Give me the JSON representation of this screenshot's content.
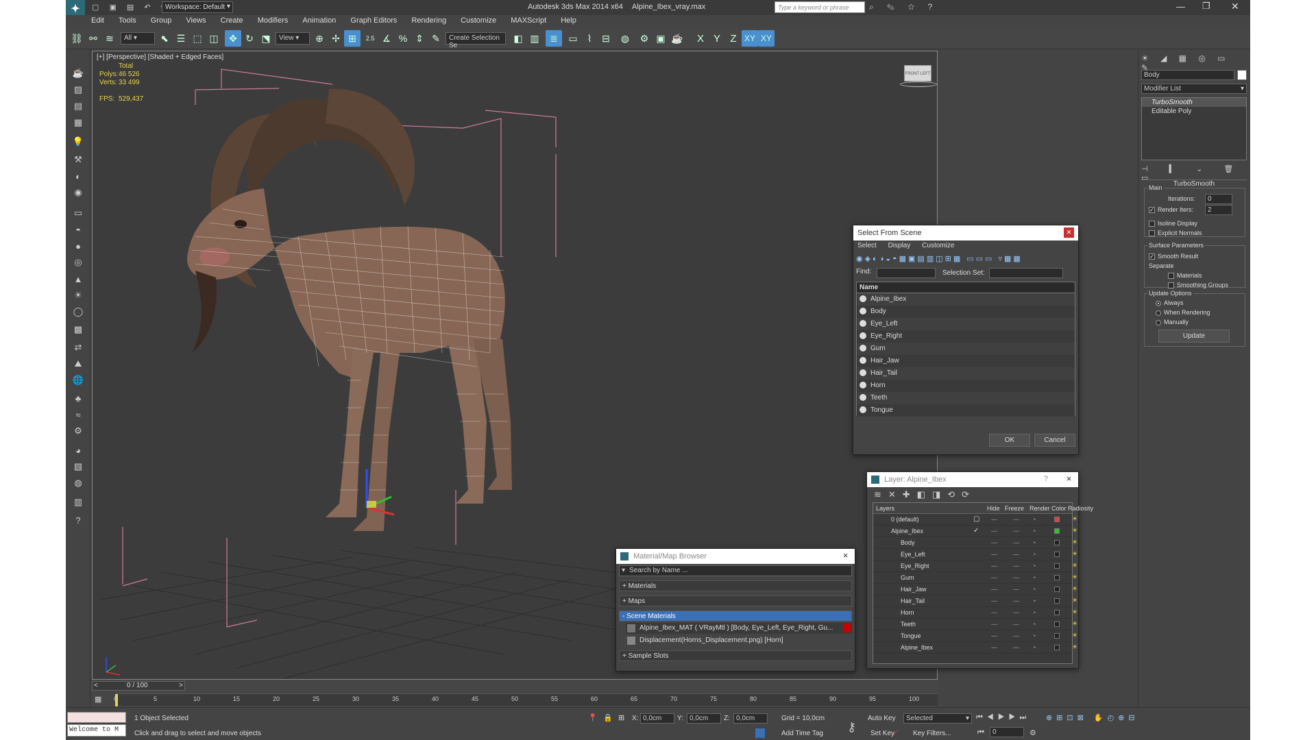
{
  "titlebar": {
    "workspace_label": "Workspace: Default",
    "app_title": "Autodesk 3ds Max  2014 x64",
    "file_name": "Alpine_Ibex_vray.max",
    "search_placeholder": "Type a keyword or phrase"
  },
  "menu": [
    "Edit",
    "Tools",
    "Group",
    "Views",
    "Create",
    "Modifiers",
    "Animation",
    "Graph Editors",
    "Rendering",
    "Customize",
    "MAXScript",
    "Help"
  ],
  "toolbar": {
    "filter_value": "All",
    "coord_value": "View",
    "selection_set_placeholder": "Create Selection Se",
    "spinner_label": "2.5",
    "axes": [
      "X",
      "Y",
      "Z",
      "XY",
      "XY"
    ]
  },
  "viewport": {
    "label": "[+] [Perspective] [Shaded + Edged Faces]",
    "stats": {
      "total_label": "Total",
      "polys_label": "Polys:",
      "polys_value": "46 526",
      "verts_label": "Verts:",
      "verts_value": "33 499",
      "fps_label": "FPS:",
      "fps_value": "529,437"
    },
    "viewcube_label": "FRONT  LEFT"
  },
  "command_panel": {
    "object_name": "Body",
    "modifier_list_label": "Modifier List",
    "stack": [
      "TurboSmooth",
      "Editable Poly"
    ],
    "rollout_title": "TurboSmooth",
    "main_label": "Main",
    "iterations_label": "Iterations:",
    "iterations_value": "0",
    "render_iters_label": "Render Iters:",
    "render_iters_value": "2",
    "isoline_label": "Isoline Display",
    "explicit_normals_label": "Explicit Normals",
    "surface_params_label": "Surface Parameters",
    "smooth_result_label": "Smooth Result",
    "separate_label": "Separate",
    "materials_label": "Materials",
    "smoothing_groups_label": "Smoothing Groups",
    "update_options_label": "Update Options",
    "always_label": "Always",
    "when_rendering_label": "When Rendering",
    "manually_label": "Manually",
    "update_button": "Update"
  },
  "select_from_scene": {
    "title": "Select From Scene",
    "menu": [
      "Select",
      "Display",
      "Customize"
    ],
    "find_label": "Find:",
    "selection_set_label": "Selection Set:",
    "column_name": "Name",
    "items": [
      "Alpine_Ibex",
      "Body",
      "Eye_Left",
      "Eye_Right",
      "Gum",
      "Hair_Jaw",
      "Hair_Tail",
      "Horn",
      "Teeth",
      "Tongue"
    ],
    "ok_label": "OK",
    "cancel_label": "Cancel"
  },
  "layer_dialog": {
    "title": "Layer: Alpine_Ibex",
    "help": "?",
    "columns": [
      "Layers",
      "Hide",
      "Freeze",
      "Render",
      "Color",
      "Radiosity"
    ],
    "rows": [
      {
        "name": "0 (default)",
        "indent": 0,
        "color": "#e04040",
        "check": "box"
      },
      {
        "name": "Alpine_Ibex",
        "indent": 0,
        "color": "#30c030",
        "check": "tick"
      },
      {
        "name": "Body",
        "indent": 1,
        "color": "#222222",
        "check": ""
      },
      {
        "name": "Eye_Left",
        "indent": 1,
        "color": "#222222",
        "check": ""
      },
      {
        "name": "Eye_Right",
        "indent": 1,
        "color": "#222222",
        "check": ""
      },
      {
        "name": "Gum",
        "indent": 1,
        "color": "#222222",
        "check": ""
      },
      {
        "name": "Hair_Jaw",
        "indent": 1,
        "color": "#222222",
        "check": ""
      },
      {
        "name": "Hair_Tail",
        "indent": 1,
        "color": "#222222",
        "check": ""
      },
      {
        "name": "Horn",
        "indent": 1,
        "color": "#222222",
        "check": ""
      },
      {
        "name": "Teeth",
        "indent": 1,
        "color": "#222222",
        "check": ""
      },
      {
        "name": "Tongue",
        "indent": 1,
        "color": "#222222",
        "check": ""
      },
      {
        "name": "Alpine_Ibex",
        "indent": 1,
        "color": "#222222",
        "check": ""
      }
    ]
  },
  "material_browser": {
    "title": "Material/Map Browser",
    "search_placeholder": "Search by Name ...",
    "sections": [
      "+ Materials",
      "+ Maps",
      "- Scene Materials"
    ],
    "scene_materials": [
      "Alpine_Ibex_MAT  ( VRayMtl ) [Body, Eye_Left, Eye_Right, Gu...",
      "Displacement(Horns_Displacement.png) [Horn]"
    ],
    "sample_slots": "+ Sample Slots"
  },
  "timeline": {
    "frame_label": "0 / 100",
    "ticks": [
      "0",
      "5",
      "10",
      "15",
      "20",
      "25",
      "30",
      "35",
      "40",
      "45",
      "50",
      "55",
      "60",
      "65",
      "70",
      "75",
      "80",
      "85",
      "90",
      "95",
      "100"
    ]
  },
  "status": {
    "script_label": "Welcome to M",
    "selected_text": "1 Object Selected",
    "hint_text": "Click and drag to select and move objects",
    "x_label": "X:",
    "x_value": "0,0cm",
    "y_label": "Y:",
    "y_value": "0,0cm",
    "z_label": "Z:",
    "z_value": "0,0cm",
    "grid_text": "Grid = 10,0cm",
    "add_time_tag": "Add Time Tag",
    "auto_key": "Auto Key",
    "set_key": "Set Key",
    "selected_dropdown": "Selected",
    "key_filters": "Key Filters...",
    "frame_value": "0"
  },
  "colors": {
    "accent": "#4a90d0",
    "stats": "#e6d44c",
    "selection_bar": "#3b6fb6"
  }
}
